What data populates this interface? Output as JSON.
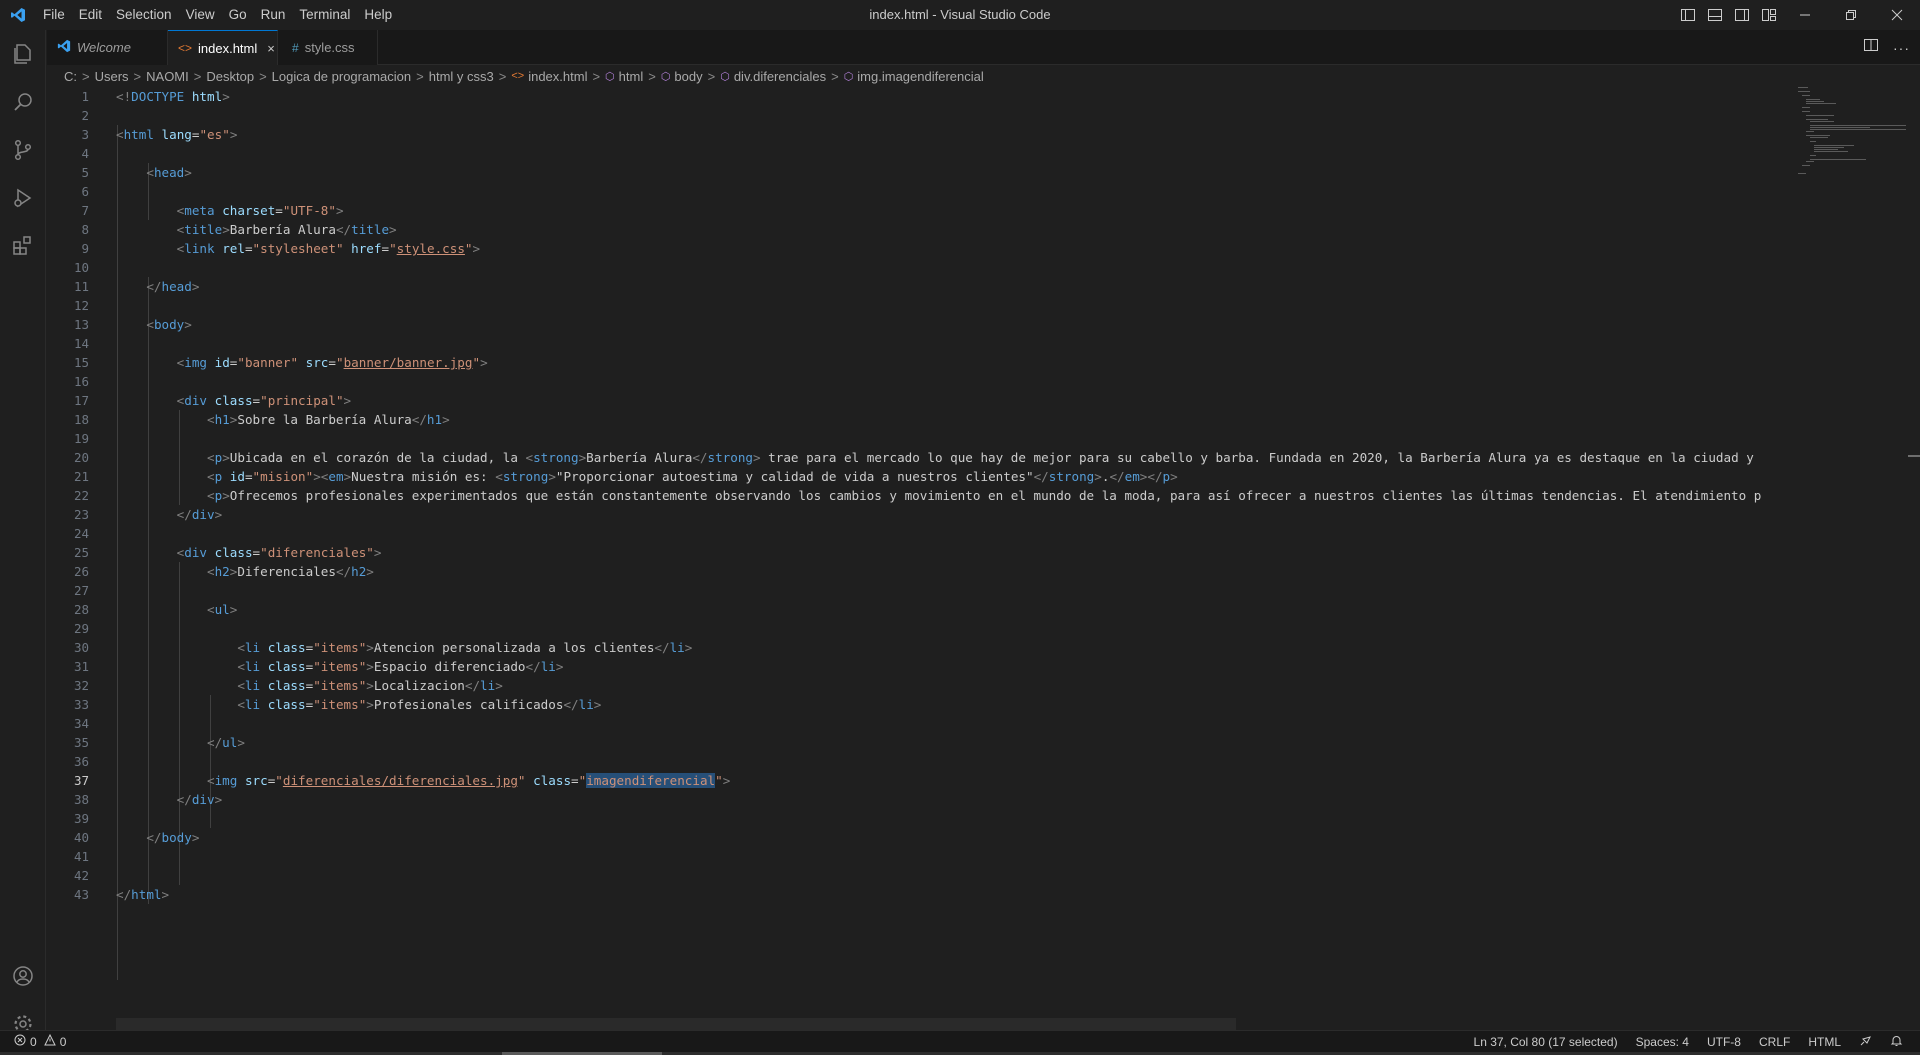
{
  "titlebar": {
    "title": "index.html - Visual Studio Code",
    "menu": [
      "File",
      "Edit",
      "Selection",
      "View",
      "Go",
      "Run",
      "Terminal",
      "Help"
    ]
  },
  "tabs": [
    {
      "label": "Welcome",
      "icon": "vscode-icon",
      "active": false
    },
    {
      "label": "index.html",
      "icon": "html-icon",
      "active": true,
      "close": "×"
    },
    {
      "label": "style.css",
      "icon": "css-icon",
      "active": false
    }
  ],
  "breadcrumb": [
    "C:",
    "Users",
    "NAOMI",
    "Desktop",
    "Logica de programacion",
    "html y css3",
    "index.html",
    "html",
    "body",
    "div.diferenciales",
    "img.imagendiferencial"
  ],
  "editor": {
    "current_line": 37
  },
  "statusbar": {
    "errors": "0",
    "warnings": "0",
    "position": "Ln 37, Col 80 (17 selected)",
    "spaces": "Spaces: 4",
    "encoding": "UTF-8",
    "eol": "CRLF",
    "language": "HTML"
  },
  "colors": {
    "accent": "#0078d4",
    "tag": "#569cd6",
    "attribute": "#9cdcfe",
    "string": "#ce9178",
    "bracket": "#808080",
    "selection": "#264f78"
  }
}
